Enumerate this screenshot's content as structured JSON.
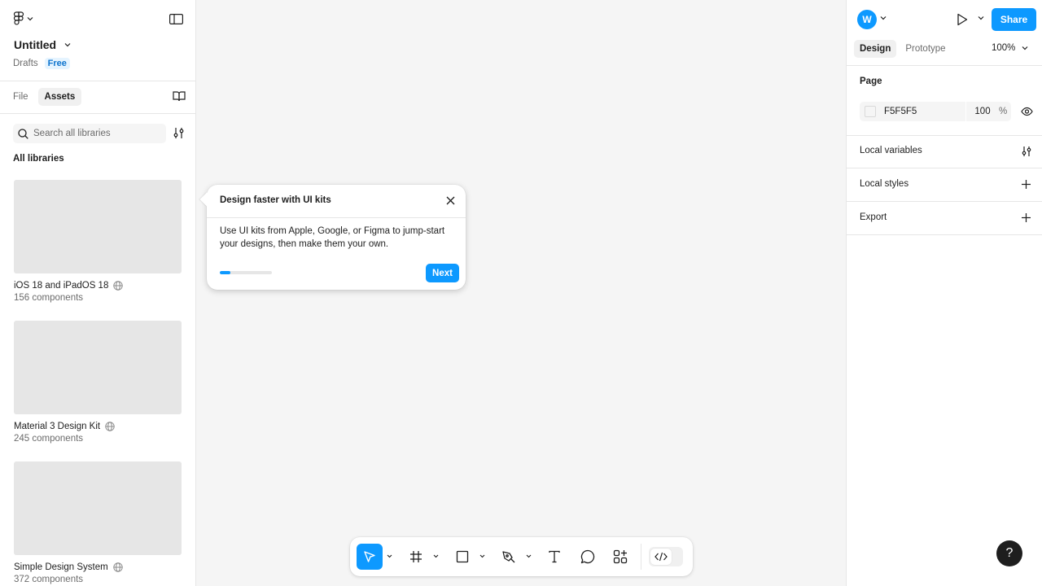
{
  "file": {
    "title": "Untitled",
    "location": "Drafts",
    "plan_badge": "Free"
  },
  "left_tabs": [
    {
      "label": "File"
    },
    {
      "label": "Assets"
    }
  ],
  "search": {
    "placeholder": "Search all libraries"
  },
  "libraries": {
    "heading": "All libraries",
    "items": [
      {
        "name": "iOS 18 and iPadOS 18",
        "count": "156 components"
      },
      {
        "name": "Material 3 Design Kit",
        "count": "245 components"
      },
      {
        "name": "Simple Design System",
        "count": "372 components"
      }
    ]
  },
  "header_right": {
    "avatar_letter": "W",
    "share_label": "Share"
  },
  "right_tabs": [
    {
      "label": "Design"
    },
    {
      "label": "Prototype"
    }
  ],
  "zoom": "100%",
  "page": {
    "label": "Page",
    "color_hex": "F5F5F5",
    "opacity": "100",
    "opacity_unit": "%"
  },
  "sections": {
    "local_variables": "Local variables",
    "local_styles": "Local styles",
    "export": "Export"
  },
  "popover": {
    "title": "Design faster with UI kits",
    "body": "Use UI kits from Apple, Google, or Figma to jump-start your designs, then make them your own.",
    "progress": 0.2,
    "next_label": "Next"
  },
  "help_label": "?",
  "colors": {
    "accent": "#0d99ff",
    "canvas": "#f5f5f5",
    "text": "#1e1e1e",
    "muted": "#6b6b6b"
  },
  "icons": [
    "figma-logo-icon",
    "chevron-down-icon",
    "sidebar-toggle-icon",
    "book-icon",
    "search-icon",
    "filter-icon",
    "globe-icon",
    "play-icon",
    "eye-icon",
    "sliders-icon",
    "plus-icon",
    "close-icon",
    "move-tool-icon",
    "frame-tool-icon",
    "rectangle-tool-icon",
    "pen-tool-icon",
    "text-tool-icon",
    "comment-tool-icon",
    "actions-icon",
    "code-icon"
  ]
}
